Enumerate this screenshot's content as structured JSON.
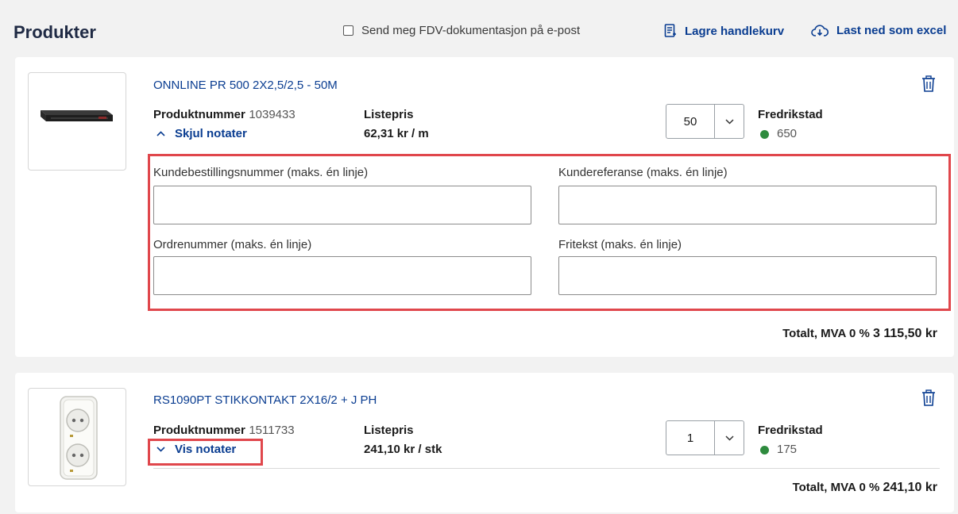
{
  "header": {
    "title": "Produkter",
    "fdv_label": "Send meg FDV-dokumentasjon på e-post",
    "save_label": "Lagre handlekurv",
    "excel_label": "Last ned som excel"
  },
  "products": [
    {
      "name": "ONNLINE PR 500 2X2,5/2,5 - 50M",
      "product_number_label": "Produktnummer",
      "product_number": "1039433",
      "notes_toggle": "Skjul notater",
      "list_price_label": "Listepris",
      "list_price": "62,31 kr / m",
      "quantity": "50",
      "store": "Fredrikstad",
      "stock": "650",
      "notes": {
        "customer_order_label": "Kundebestillingsnummer (maks. én linje)",
        "customer_ref_label": "Kundereferanse (maks. én linje)",
        "order_number_label": "Ordrenummer (maks. én linje)",
        "free_text_label": "Fritekst (maks. én linje)"
      },
      "total_label": "Totalt, MVA 0 %",
      "total": "3 115,50 kr"
    },
    {
      "name": "RS1090PT STIKKONTAKT 2X16/2 + J PH",
      "product_number_label": "Produktnummer",
      "product_number": "1511733",
      "notes_toggle": "Vis notater",
      "list_price_label": "Listepris",
      "list_price": "241,10 kr / stk",
      "quantity": "1",
      "store": "Fredrikstad",
      "stock": "175",
      "total_label": "Totalt, MVA 0 %",
      "total": "241,10 kr"
    }
  ],
  "colors": {
    "link": "#0a3d91",
    "stock_ok": "#2e8b3e",
    "highlight": "#e0474c"
  }
}
